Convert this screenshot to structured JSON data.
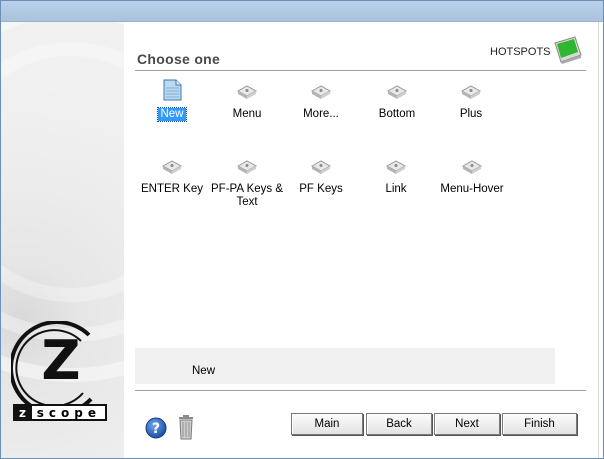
{
  "header": {
    "title": "Choose one",
    "hotspots_label": "HOTSPOTS"
  },
  "items": [
    {
      "label": "New",
      "icon": "new-document-icon",
      "selected": true
    },
    {
      "label": "Menu",
      "icon": "keyboard-key-icon"
    },
    {
      "label": "More...",
      "icon": "keyboard-key-icon"
    },
    {
      "label": "Bottom",
      "icon": "keyboard-key-icon"
    },
    {
      "label": "Plus",
      "icon": "keyboard-key-icon"
    },
    {
      "label": "ENTER Key",
      "icon": "keyboard-key-icon"
    },
    {
      "label": "PF-PA Keys & Text",
      "icon": "keyboard-key-icon"
    },
    {
      "label": "PF Keys",
      "icon": "keyboard-key-icon"
    },
    {
      "label": "Link",
      "icon": "keyboard-key-icon"
    },
    {
      "label": "Menu-Hover",
      "icon": "keyboard-key-icon"
    }
  ],
  "description": {
    "text": "New"
  },
  "footer": {
    "buttons": {
      "main": "Main",
      "back": "Back",
      "next": "Next",
      "finish": "Finish"
    }
  },
  "branding": {
    "logo_letter": "Z",
    "logo_text": "scope"
  },
  "colors": {
    "selection": "#3399ff",
    "titlebar": "#b9d1ea",
    "help": "#1f5fbf"
  }
}
